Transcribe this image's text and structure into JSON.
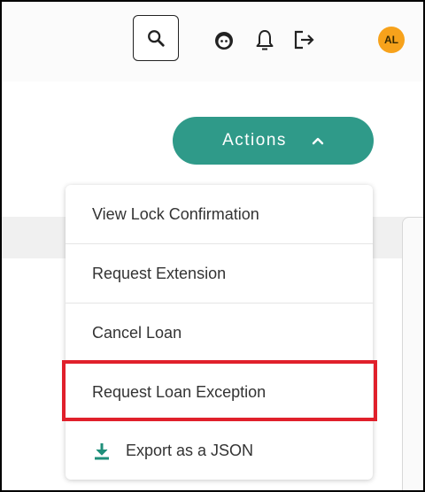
{
  "header": {
    "avatar_initials": "AL",
    "icons": [
      "search-icon",
      "support-face-icon",
      "bell-icon",
      "logout-icon"
    ]
  },
  "actions": {
    "label": "Actions",
    "chevron": "^"
  },
  "menu": {
    "items": [
      {
        "label": "View Lock Confirmation"
      },
      {
        "label": "Request Extension"
      },
      {
        "label": "Cancel Loan"
      },
      {
        "label": "Request Loan Exception",
        "highlighted": true
      },
      {
        "label": "Export as a JSON",
        "icon": "download-icon"
      }
    ]
  },
  "colors": {
    "accent": "#2f9a89",
    "avatar": "#f7a21b",
    "highlight": "#e0202b",
    "download_icon": "#1f8f7a"
  }
}
